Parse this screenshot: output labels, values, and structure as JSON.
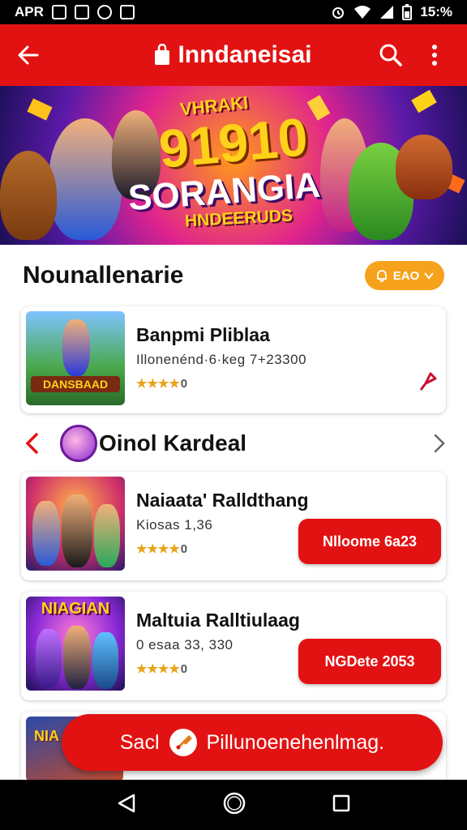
{
  "status_bar": {
    "left_text": "APR",
    "time": "15:%"
  },
  "app_bar": {
    "title": "Inndaneisai"
  },
  "banner": {
    "line1": "VHRAKI",
    "number": "91910",
    "word": "SORANGIA",
    "sub": "HNDEERUDS"
  },
  "section": {
    "title": "Nounallenarie",
    "chip_label": "EAO"
  },
  "featured": {
    "name": "Banpmi Pliblaa",
    "meta": "Illonenénd·6·keg 7+23300",
    "stars": "★★★★",
    "rating": "0",
    "thumb_text": "DANSBAAD"
  },
  "nav_row": {
    "title": "Oinol Kardeal"
  },
  "items": [
    {
      "name": "Naiaata' Ralldthang",
      "meta": "Kiosas 1,36",
      "stars": "★★★★",
      "rating": "0",
      "cta": "Nlloome 6a23"
    },
    {
      "name": "Maltuia Ralltiulaag",
      "meta": "0 esaa 33, 330",
      "stars": "★★★★",
      "rating": "0",
      "cta": "NGDete 2053",
      "thumb_text": "NIAGIAN"
    }
  ],
  "float_bar": {
    "left": "Sacl",
    "right": "Pillunoenehenlmag."
  },
  "peek": {
    "thumb_text": "NIA"
  },
  "colors": {
    "brand_red": "#e31212",
    "chip_orange": "#f6a21c",
    "star_gold": "#e8a317"
  }
}
